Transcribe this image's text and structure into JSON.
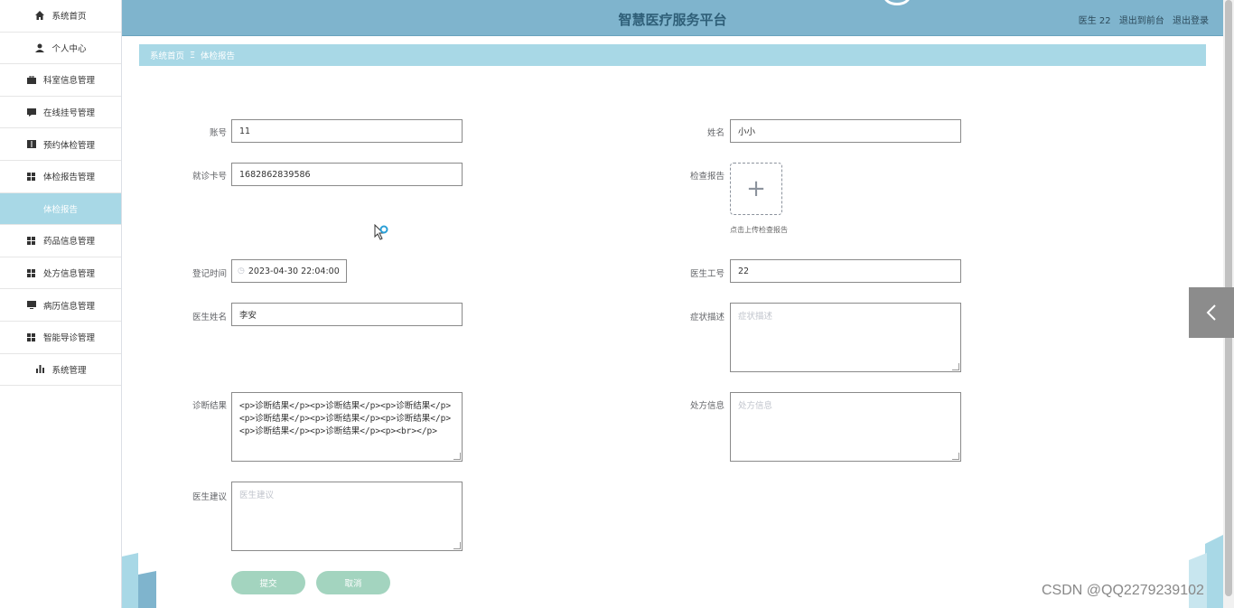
{
  "sidebar": {
    "items": [
      {
        "label": "系统首页",
        "icon": "home-icon"
      },
      {
        "label": "个人中心",
        "icon": "user-icon"
      },
      {
        "label": "科室信息管理",
        "icon": "briefcase-icon"
      },
      {
        "label": "在线挂号管理",
        "icon": "chat-icon"
      },
      {
        "label": "预约体检管理",
        "icon": "book-icon"
      },
      {
        "label": "体检报告管理",
        "icon": "grid-icon"
      },
      {
        "label": "体检报告",
        "icon": "",
        "active": true
      },
      {
        "label": "药品信息管理",
        "icon": "grid-icon"
      },
      {
        "label": "处方信息管理",
        "icon": "grid-icon"
      },
      {
        "label": "病历信息管理",
        "icon": "monitor-icon"
      },
      {
        "label": "智能导诊管理",
        "icon": "grid-icon"
      },
      {
        "label": "系统管理",
        "icon": "bar-chart-icon"
      }
    ]
  },
  "header": {
    "title": "智慧医疗服务平台",
    "user": "医生 22",
    "back_front": "退出到前台",
    "logout": "退出登录",
    "bg_color": "#7fb4cd"
  },
  "breadcrumb": {
    "home": "系统首页",
    "sep": "Ξ",
    "current": "体检报告"
  },
  "form": {
    "account": {
      "label": "账号",
      "value": "11"
    },
    "name": {
      "label": "姓名",
      "value": "小小"
    },
    "card": {
      "label": "就诊卡号",
      "value": "1682862839586"
    },
    "report": {
      "label": "检查报告",
      "tip": "点击上传检查报告"
    },
    "reg_time": {
      "label": "登记时间",
      "value": "2023-04-30 22:04:00"
    },
    "doctor_no": {
      "label": "医生工号",
      "value": "22"
    },
    "doctor_name": {
      "label": "医生姓名",
      "value": "李安"
    },
    "symptom": {
      "label": "症状描述",
      "placeholder": "症状描述"
    },
    "diagnosis": {
      "label": "诊断结果",
      "value": "<p>诊断结果</p><p>诊断结果</p><p>诊断结果</p><p>诊断结果</p><p>诊断结果</p><p>诊断结果</p><p>诊断结果</p><p>诊断结果</p><p><br></p>"
    },
    "prescription": {
      "label": "处方信息",
      "placeholder": "处方信息"
    },
    "advice": {
      "label": "医生建议",
      "placeholder": "医生建议"
    },
    "submit": "提交",
    "cancel": "取消"
  },
  "watermark": "CSDN @QQ2279239102",
  "colors": {
    "accent": "#a8d8e6",
    "button": "#a3d4bf"
  }
}
